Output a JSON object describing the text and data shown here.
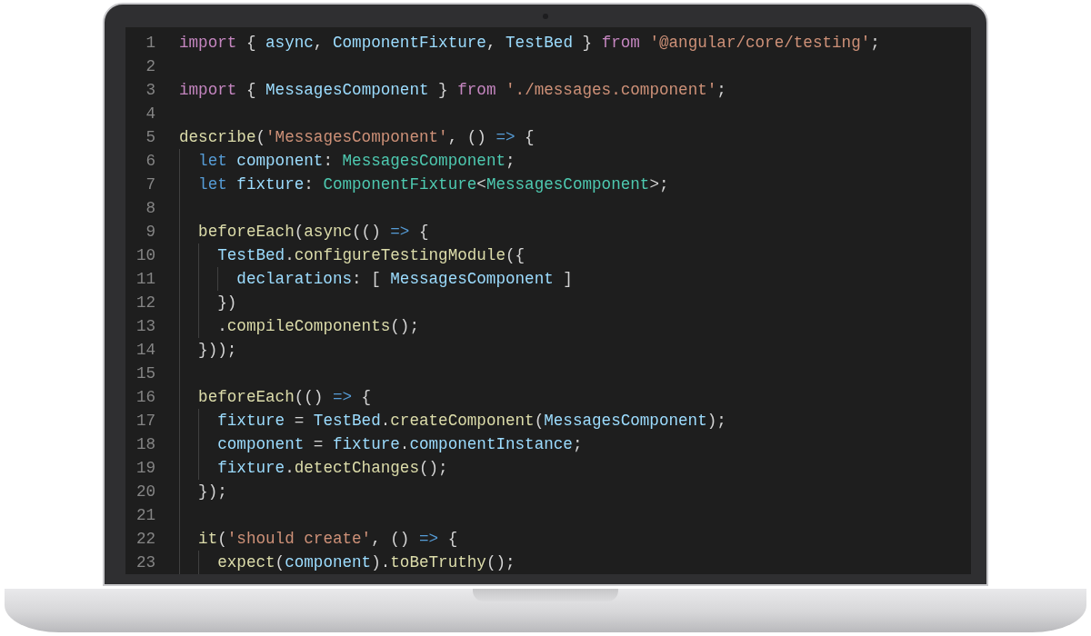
{
  "editor": {
    "lines": [
      {
        "number": "1",
        "tokens": [
          {
            "kind": "keyword",
            "text": "import"
          },
          {
            "kind": "plain",
            "text": " { "
          },
          {
            "kind": "variable",
            "text": "async"
          },
          {
            "kind": "plain",
            "text": ", "
          },
          {
            "kind": "variable",
            "text": "ComponentFixture"
          },
          {
            "kind": "plain",
            "text": ", "
          },
          {
            "kind": "variable",
            "text": "TestBed"
          },
          {
            "kind": "plain",
            "text": " } "
          },
          {
            "kind": "keyword",
            "text": "from"
          },
          {
            "kind": "string",
            "text": " '@angular/core/testing'"
          },
          {
            "kind": "plain",
            "text": ";"
          }
        ]
      },
      {
        "number": "2"
      },
      {
        "number": "3",
        "tokens": [
          {
            "kind": "keyword",
            "text": "import"
          },
          {
            "kind": "plain",
            "text": " { "
          },
          {
            "kind": "variable",
            "text": "MessagesComponent"
          },
          {
            "kind": "plain",
            "text": " } "
          },
          {
            "kind": "keyword",
            "text": "from"
          },
          {
            "kind": "string",
            "text": " './messages.component'"
          },
          {
            "kind": "plain",
            "text": ";"
          }
        ]
      },
      {
        "number": "4"
      },
      {
        "number": "5",
        "tokens": [
          {
            "kind": "function",
            "text": "describe"
          },
          {
            "kind": "plain",
            "text": "("
          },
          {
            "kind": "string",
            "text": "'MessagesComponent'"
          },
          {
            "kind": "plain",
            "text": ", () "
          },
          {
            "kind": "storage",
            "text": "=>"
          },
          {
            "kind": "plain",
            "text": " {"
          }
        ]
      },
      {
        "number": "6",
        "tokens": [
          {
            "kind": "storage",
            "text": "  let"
          },
          {
            "kind": "variable",
            "text": " component"
          },
          {
            "kind": "plain",
            "text": ": "
          },
          {
            "kind": "type",
            "text": "MessagesComponent"
          },
          {
            "kind": "plain",
            "text": ";"
          }
        ]
      },
      {
        "number": "7",
        "tokens": [
          {
            "kind": "storage",
            "text": "  let"
          },
          {
            "kind": "variable",
            "text": " fixture"
          },
          {
            "kind": "plain",
            "text": ": "
          },
          {
            "kind": "type",
            "text": "ComponentFixture"
          },
          {
            "kind": "plain",
            "text": "<"
          },
          {
            "kind": "type",
            "text": "MessagesComponent"
          },
          {
            "kind": "plain",
            "text": ">;"
          }
        ]
      },
      {
        "number": "8"
      },
      {
        "number": "9",
        "tokens": [
          {
            "kind": "function",
            "text": "  beforeEach"
          },
          {
            "kind": "plain",
            "text": "("
          },
          {
            "kind": "function",
            "text": "async"
          },
          {
            "kind": "plain",
            "text": "(() "
          },
          {
            "kind": "storage",
            "text": "=>"
          },
          {
            "kind": "plain",
            "text": " {"
          }
        ]
      },
      {
        "number": "10",
        "tokens": [
          {
            "kind": "variable",
            "text": "    TestBed"
          },
          {
            "kind": "plain",
            "text": "."
          },
          {
            "kind": "function",
            "text": "configureTestingModule"
          },
          {
            "kind": "plain",
            "text": "({"
          }
        ]
      },
      {
        "number": "11",
        "tokens": [
          {
            "kind": "variable",
            "text": "      declarations"
          },
          {
            "kind": "plain",
            "text": ": [ "
          },
          {
            "kind": "variable",
            "text": "MessagesComponent"
          },
          {
            "kind": "plain",
            "text": " ]"
          }
        ]
      },
      {
        "number": "12",
        "tokens": [
          {
            "kind": "plain",
            "text": "    })"
          }
        ]
      },
      {
        "number": "13",
        "tokens": [
          {
            "kind": "plain",
            "text": "    ."
          },
          {
            "kind": "function",
            "text": "compileComponents"
          },
          {
            "kind": "plain",
            "text": "();"
          }
        ]
      },
      {
        "number": "14",
        "tokens": [
          {
            "kind": "plain",
            "text": "  }));"
          }
        ]
      },
      {
        "number": "15"
      },
      {
        "number": "16",
        "tokens": [
          {
            "kind": "function",
            "text": "  beforeEach"
          },
          {
            "kind": "plain",
            "text": "(() "
          },
          {
            "kind": "storage",
            "text": "=>"
          },
          {
            "kind": "plain",
            "text": " {"
          }
        ]
      },
      {
        "number": "17",
        "tokens": [
          {
            "kind": "variable",
            "text": "    fixture"
          },
          {
            "kind": "plain",
            "text": " = "
          },
          {
            "kind": "variable",
            "text": "TestBed"
          },
          {
            "kind": "plain",
            "text": "."
          },
          {
            "kind": "function",
            "text": "createComponent"
          },
          {
            "kind": "plain",
            "text": "("
          },
          {
            "kind": "variable",
            "text": "MessagesComponent"
          },
          {
            "kind": "plain",
            "text": ");"
          }
        ]
      },
      {
        "number": "18",
        "tokens": [
          {
            "kind": "variable",
            "text": "    component"
          },
          {
            "kind": "plain",
            "text": " = "
          },
          {
            "kind": "variable",
            "text": "fixture"
          },
          {
            "kind": "plain",
            "text": "."
          },
          {
            "kind": "variable",
            "text": "componentInstance"
          },
          {
            "kind": "plain",
            "text": ";"
          }
        ]
      },
      {
        "number": "19",
        "tokens": [
          {
            "kind": "variable",
            "text": "    fixture"
          },
          {
            "kind": "plain",
            "text": "."
          },
          {
            "kind": "function",
            "text": "detectChanges"
          },
          {
            "kind": "plain",
            "text": "();"
          }
        ]
      },
      {
        "number": "20",
        "tokens": [
          {
            "kind": "plain",
            "text": "  });"
          }
        ]
      },
      {
        "number": "21"
      },
      {
        "number": "22",
        "tokens": [
          {
            "kind": "function",
            "text": "  it"
          },
          {
            "kind": "plain",
            "text": "("
          },
          {
            "kind": "string",
            "text": "'should create'"
          },
          {
            "kind": "plain",
            "text": ", () "
          },
          {
            "kind": "storage",
            "text": "=>"
          },
          {
            "kind": "plain",
            "text": " {"
          }
        ]
      },
      {
        "number": "23",
        "tokens": [
          {
            "kind": "function",
            "text": "    expect"
          },
          {
            "kind": "plain",
            "text": "("
          },
          {
            "kind": "variable",
            "text": "component"
          },
          {
            "kind": "plain",
            "text": ")."
          },
          {
            "kind": "function",
            "text": "toBeTruthy"
          },
          {
            "kind": "plain",
            "text": "();"
          }
        ]
      }
    ]
  }
}
